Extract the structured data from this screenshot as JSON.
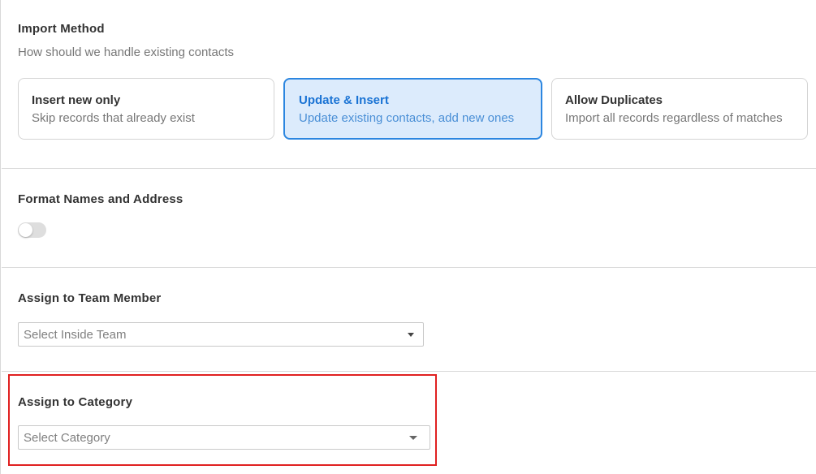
{
  "import_method": {
    "title": "Import Method",
    "subtitle": "How should we handle existing contacts",
    "options": [
      {
        "title": "Insert new only",
        "description": "Skip records that already exist",
        "selected": false
      },
      {
        "title": "Update & Insert",
        "description": "Update existing contacts, add new ones",
        "selected": true
      },
      {
        "title": "Allow Duplicates",
        "description": "Import all records regardless of matches",
        "selected": false
      }
    ]
  },
  "format_names": {
    "title": "Format Names and Address",
    "toggle_on": false
  },
  "team_member": {
    "title": "Assign to Team Member",
    "select_value": "Select Inside Team"
  },
  "category": {
    "title": "Assign to Category",
    "select_value": "Select Category"
  },
  "colors": {
    "accent": "#2c86e0",
    "selected_bg": "#dcebfc",
    "highlight": "#e02020"
  },
  "icons": {
    "dropdown": "caret-down-icon"
  }
}
